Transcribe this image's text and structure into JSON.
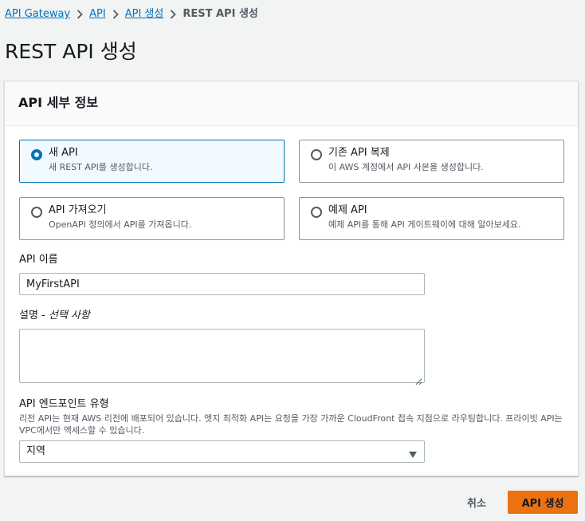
{
  "breadcrumb": {
    "items": [
      "API Gateway",
      "API",
      "API 생성"
    ],
    "current": "REST API 생성"
  },
  "page": {
    "title": "REST API 생성"
  },
  "panel": {
    "title": "API 세부 정보",
    "options": [
      {
        "title": "새 API",
        "description": "새 REST API를 생성합니다.",
        "selected": true
      },
      {
        "title": "기존 API 복제",
        "description": "이 AWS 계정에서 API 사본을 생성합니다.",
        "selected": false
      },
      {
        "title": "API 가져오기",
        "description": "OpenAPI 정의에서 API를 가져옵니다.",
        "selected": false
      },
      {
        "title": "예제 API",
        "description": "예제 API를 통해 API 게이트웨이에 대해 알아보세요.",
        "selected": false
      }
    ],
    "name_field": {
      "label": "API 이름",
      "value": "MyFirstAPI"
    },
    "description_field": {
      "label": "설명 - ",
      "label_optional": "선택 사항",
      "value": ""
    },
    "endpoint_field": {
      "label": "API 엔드포인트 유형",
      "description": "리전 API는 현재 AWS 리전에 배포되어 있습니다. 엣지 최적화 API는 요청을 가장 가까운 CloudFront 접속 지점으로 라우팅합니다. 프라이빗 API는 VPC에서만 액세스할 수 있습니다.",
      "selected": "지역"
    }
  },
  "actions": {
    "cancel": "취소",
    "create": "API 생성"
  },
  "colors": {
    "link": "#0073bb",
    "selected_border": "#0073bb",
    "selected_background": "#f1faff",
    "primary_button": "#ec7211",
    "page_background": "#f2f3f3"
  },
  "icons": {
    "breadcrumb_separator": "chevron-right-icon",
    "select_caret": "caret-down-icon",
    "textarea_resize": "resize-grip-icon"
  }
}
